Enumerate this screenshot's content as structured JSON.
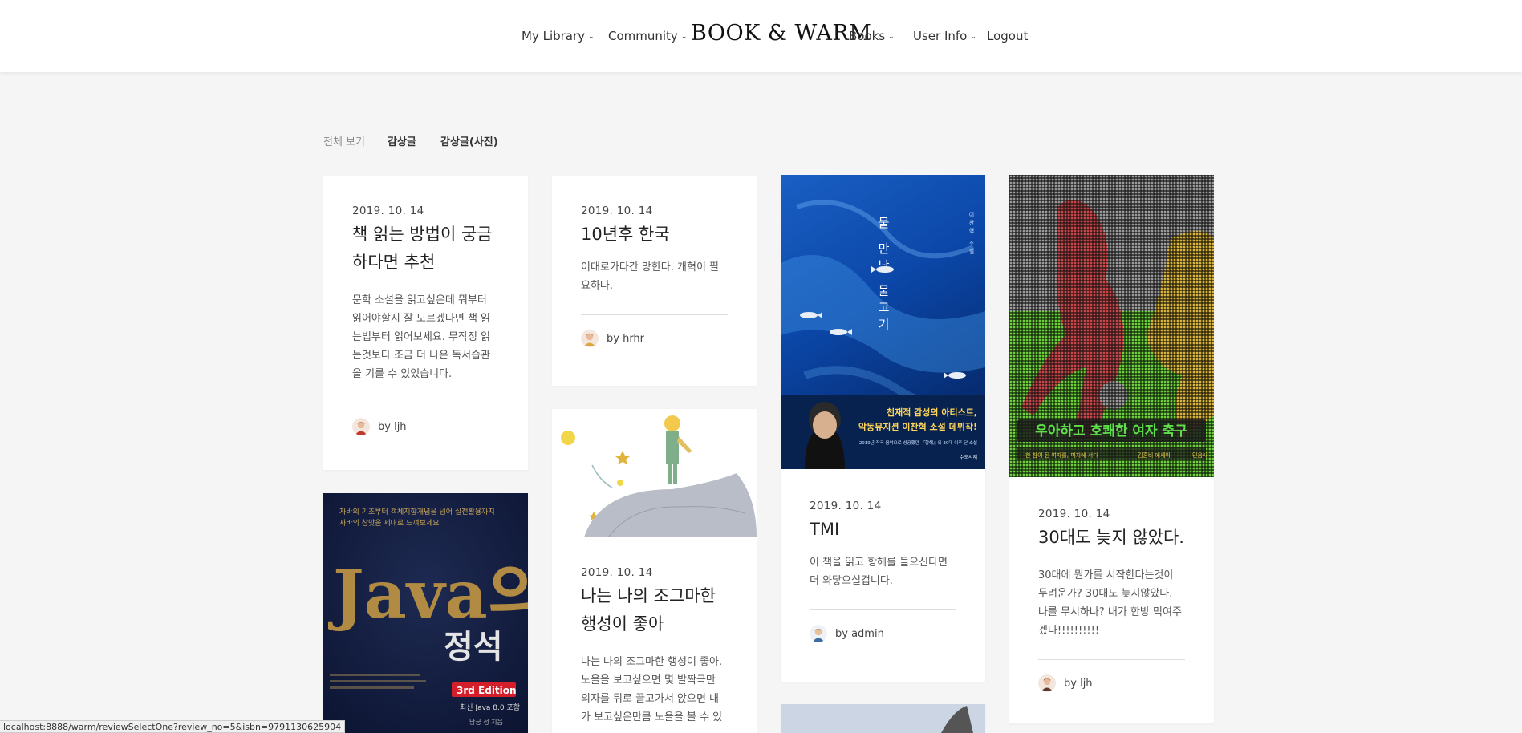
{
  "nav": {
    "items": [
      {
        "label": "My Library",
        "dropdown": true
      },
      {
        "label": "Community",
        "dropdown": true
      },
      {
        "label": "Books",
        "dropdown": true
      },
      {
        "label": "User Info",
        "dropdown": true
      },
      {
        "label": "Logout",
        "dropdown": false
      }
    ],
    "brand": "BOOK & WARM"
  },
  "filters": [
    "전체 보기",
    "감상글",
    "감상글(사진)"
  ],
  "cards": [
    {
      "date": "2019. 10. 14",
      "title": "책 읽는 방법이 궁금하다면 추천",
      "excerpt": "문학 소설을 읽고싶은데 뭐부터 읽어야할지 잘 모르겠다면 책 읽는법부터 읽어보세요. 무작정 읽는것보다 조금 더 나은 독서습관을 기를 수 있었습니다.",
      "author": "by ljh"
    },
    {
      "date": "2019. 10. 14",
      "title": "10년후 한국",
      "excerpt": "이대로가다간 망한다. 개혁이 필요하다.",
      "author": "by hrhr"
    },
    {
      "date": "2019. 10. 14",
      "title": "TMI",
      "excerpt": "이 책을 읽고 항해를 들으신다면 더 와닿으실겁니다.",
      "author": "by admin"
    },
    {
      "date": "2019. 10. 14",
      "title": "30대도 늦지 않았다.",
      "excerpt": "30대에 뭔가를 시작한다는것이 두려운가? 30대도 늦지않았다. 나를 무시하나? 내가 한방 먹여주겠다!!!!!!!!!!",
      "author": "by ljh"
    },
    {
      "date": "2019. 10. 14",
      "title": "나는 나의 조그마한 행성이 좋아",
      "excerpt": "나는 나의 조그마한 행성이 좋아. 노을을 보고싶으면 몇 발짝극만 의자를 뒤로 끌고가서 앉으면 내가 보고싶은만큼 노을을 볼 수 있",
      "author": ""
    }
  ],
  "covers": {
    "fish": {
      "vertical_title": "물 만난 물고기",
      "author_vertical": "이찬혁 소설",
      "tagline1": "천재적 감성의 아티스트,",
      "tagline2": "악동뮤지션 이찬혁 소설 데뷔작!",
      "small": "2019년 작곡 음악으로 성공했던 『항해』의 30대 이후 단 소설",
      "publisher": "수오서재"
    },
    "football": {
      "title": "우아하고 호쾌한 여자 축구",
      "sub": "한 참이 된 여자를, 피치에 서다",
      "author": "김혼비 에세이",
      "publisher": "민음사"
    },
    "java": {
      "top1": "자바의 기초부터 객체지향개념을 넘어 실전활용까지",
      "top2": "자바의 참맛을 제대로 느껴보세요",
      "title": "Java의",
      "title2": "정석",
      "edition": "3rd Edition",
      "sub": "최신 Java 8.0 포함",
      "author": "남궁 성 지음"
    }
  },
  "status_url": "localhost:8888/warm/reviewSelectOne?review_no=5&isbn=9791130625904"
}
